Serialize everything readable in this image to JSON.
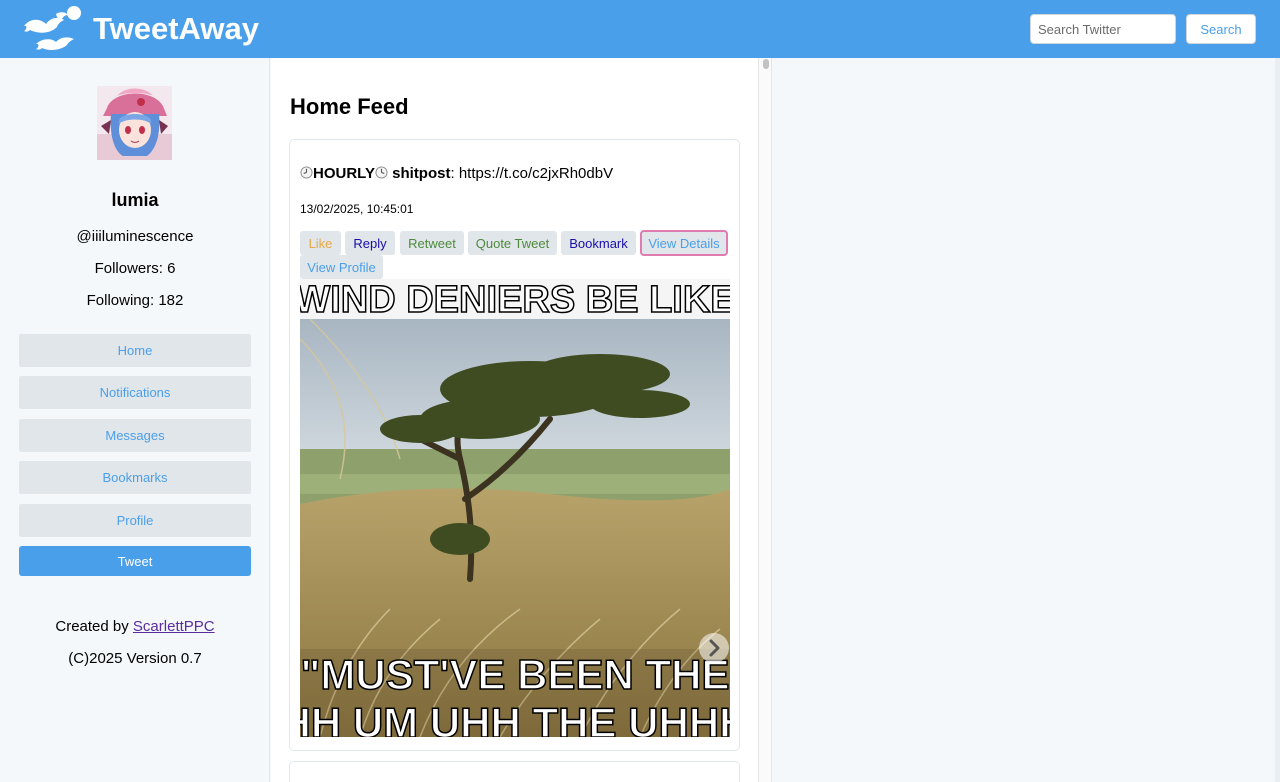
{
  "header": {
    "brand": "TweetAway",
    "search_placeholder": "Search Twitter",
    "search_button": "Search"
  },
  "sidebar": {
    "display_name": "lumia",
    "handle": "@iiiluminescence",
    "followers": "Followers: 6",
    "following": "Following: 182",
    "nav": [
      "Home",
      "Notifications",
      "Messages",
      "Bookmarks",
      "Profile"
    ],
    "tweet_button": "Tweet",
    "credit_prefix": "Created by ",
    "credit_link": "ScarlettPPC",
    "version": "(C)2025 Version 0.7"
  },
  "feed": {
    "title": "Home Feed",
    "tweet": {
      "label_hourly": "HOURLY",
      "label_shitpost": "shitpost",
      "link": ": https://t.co/c2jxRh0dbV",
      "timestamp": "13/02/2025, 10:45:01",
      "actions": {
        "like": "Like",
        "reply": "Reply",
        "retweet": "Retweet",
        "quote": "Quote Tweet",
        "bookmark": "Bookmark",
        "details": "View Details",
        "profile": "View Profile"
      },
      "media_caption_top": "WIND DENIERS BE LIKE",
      "media_caption_bottom1": "\"MUST'VE BEEN THE",
      "media_caption_bottom2": "HH UM UHH THE UHHH"
    }
  },
  "colors": {
    "header_bg": "#4a9fea",
    "accent": "#4a9fea",
    "like": "#e8a845",
    "reply": "#1a0dab",
    "retweet": "#4e8a3e",
    "details_border": "#e07bb0"
  }
}
